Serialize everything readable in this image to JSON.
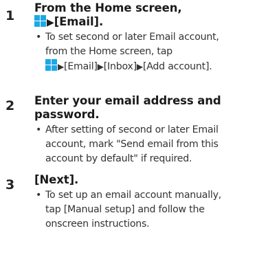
{
  "colors": {
    "apps_icon": "#1ba8e6",
    "text": "#333333"
  },
  "icons": {
    "apps": "apps-grid-icon",
    "arrow": "triangle-right-icon"
  },
  "steps": [
    {
      "number": "1",
      "title_line1": "From the Home screen,",
      "title_line2": "[Email].",
      "bullet_line1": "To set second or later Email account,",
      "bullet_line2": "from the Home screen, tap",
      "bullet_line3": {
        "part1": "[Email]",
        "part2": "[Inbox]",
        "part3": "[Add account]."
      }
    },
    {
      "number": "2",
      "title_line1": "Enter your email address and",
      "title_line2": "password.",
      "bullet_lines": [
        "After setting of second or later Email",
        "account, mark \"Send email from this",
        "account by default\" if required."
      ]
    },
    {
      "number": "3",
      "title_line1": "[Next].",
      "bullet_lines": [
        "To set up an email account manually,",
        "tap [Manual setup] and follow the",
        "onscreen instructions."
      ]
    }
  ],
  "bullet_char": "•",
  "arrow_char": "▶"
}
